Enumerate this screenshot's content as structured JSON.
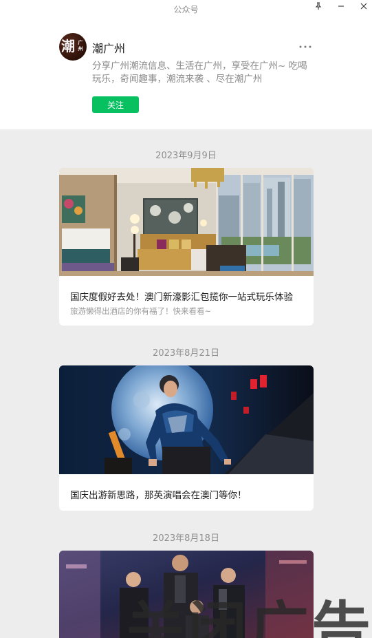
{
  "window": {
    "title": "公众号",
    "controls": {
      "pin": "pin-icon",
      "minimize": "minimize-icon",
      "close": "close-icon"
    }
  },
  "account": {
    "avatar_text": "潮",
    "avatar_subtext": "广州",
    "name": "潮广州",
    "description": "分享广州潮流信息、生活在广州，享受在广州~ 吃喝玩乐，奇闻趣事，潮流来袭 、尽在潮广州",
    "follow_label": "关注",
    "more_icon": "more-icon"
  },
  "articles": [
    {
      "date": "2023年9月9日",
      "title": "国庆度假好去处！澳门新濠影汇包揽你一站式玩乐体验",
      "subtitle": "旅游懒得出酒店的你有福了！快来看看~",
      "image": "hotel-room"
    },
    {
      "date": "2023年8月21日",
      "title": "国庆出游新思路，那英演唱会在澳门等你！",
      "subtitle": "",
      "image": "concert-singer"
    },
    {
      "date": "2023年8月18日",
      "title": "",
      "subtitle": "",
      "image": "boy-band-stage"
    }
  ],
  "watermark": "关闭广告",
  "colors": {
    "accent": "#07c160",
    "background": "#ededed"
  }
}
